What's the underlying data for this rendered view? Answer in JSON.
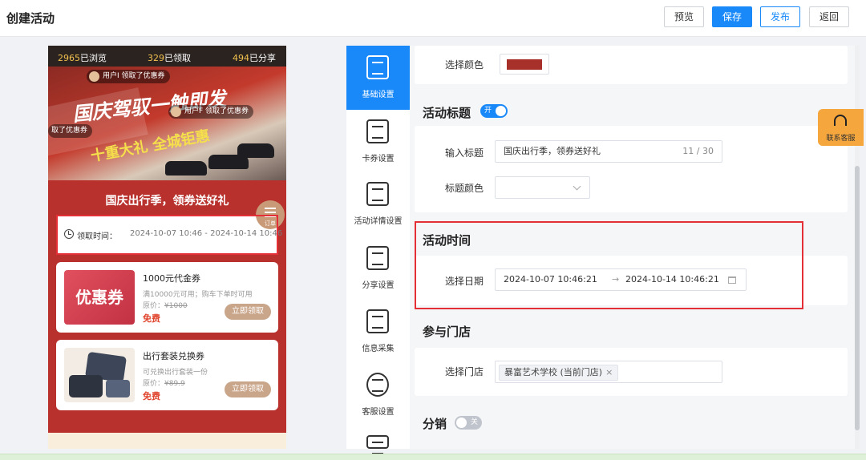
{
  "header": {
    "title": "创建活动",
    "buttons": {
      "preview": "预览",
      "save": "保存",
      "publish": "发布",
      "back": "返回"
    }
  },
  "preview": {
    "stats": {
      "views_num": "2965",
      "views_label": "已浏览",
      "claimed_num": "329",
      "claimed_label": "已领取",
      "shared_num": "494",
      "shared_label": "已分享"
    },
    "banner": {
      "slogan1": "国庆驾驭一触即发",
      "slogan2": "十重大礼 全城钜惠"
    },
    "bubbles": [
      "用户I 领取了优惠券",
      "用户F 领取了优惠券",
      "取了优惠券"
    ],
    "kefu_tag": "客服",
    "event_title": "国庆出行季，领券送好礼",
    "float_label": "订单",
    "time_label": "领取时间：",
    "time_value": "2024-10-07 10:46 - 2024-10-14 10:46",
    "coupons": [
      {
        "thumb_text": "优惠券",
        "name": "1000元代金券",
        "desc": "满10000元可用；购车下单时可用",
        "orig_label": "原价：",
        "orig_price": "¥1000",
        "price": "免费",
        "button": "立即领取"
      },
      {
        "thumb_text": "",
        "name": "出行套装兑换券",
        "desc": "可兑换出行套装一份",
        "orig_label": "原价：",
        "orig_price": "¥89.9",
        "price": "免费",
        "button": "立即领取"
      }
    ]
  },
  "nav": {
    "items": [
      {
        "label": "基础设置",
        "icon": "document-icon",
        "active": true
      },
      {
        "label": "卡券设置",
        "icon": "ticket-icon"
      },
      {
        "label": "活动详情设置",
        "icon": "detail-icon"
      },
      {
        "label": "分享设置",
        "icon": "share-icon"
      },
      {
        "label": "信息采集",
        "icon": "form-user-icon"
      },
      {
        "label": "客服设置",
        "icon": "headset-icon"
      }
    ]
  },
  "form": {
    "color_section": {
      "label": "选择颜色",
      "color": "#a8302a"
    },
    "title_section": {
      "title": "活动标题",
      "switch_text": "开",
      "input_label": "输入标题",
      "input_value": "国庆出行季，领券送好礼",
      "counter": "11 / 30",
      "color_label": "标题颜色"
    },
    "time_section": {
      "title": "活动时间",
      "date_label": "选择日期",
      "start": "2024-10-07 10:46:21",
      "arrow": "→",
      "end": "2024-10-14 10:46:21"
    },
    "store_section": {
      "title": "参与门店",
      "label": "选择门店",
      "tag": "暴富艺术学校 (当前门店)",
      "tag_close": "×"
    },
    "distribution": {
      "title": "分销",
      "switch_text": "关"
    }
  },
  "support": {
    "label": "联系客服"
  },
  "colors": {
    "primary": "#1989fa",
    "highlight": "#e42f36",
    "phone_bg": "#b8312c",
    "support_bg": "#f5a63d"
  }
}
